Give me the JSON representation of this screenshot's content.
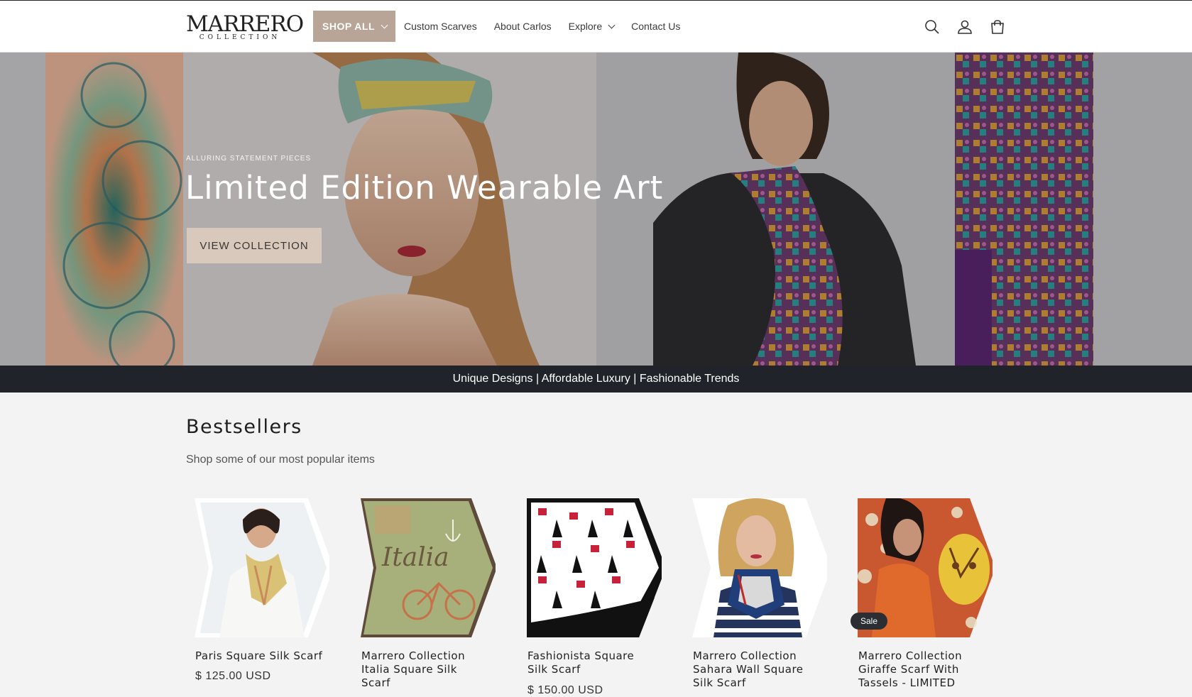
{
  "header": {
    "logo_text": "MARRERO",
    "logo_sub": "COLLECTION",
    "nav": [
      {
        "label": "SHOP ALL",
        "dropdown": true,
        "active": true
      },
      {
        "label": "Custom Scarves"
      },
      {
        "label": "About Carlos"
      },
      {
        "label": "Explore",
        "dropdown": true
      },
      {
        "label": "Contact Us"
      }
    ],
    "icons": [
      "search-icon",
      "account-icon",
      "cart-icon"
    ]
  },
  "hero": {
    "subheading": "ALLURING STATEMENT PIECES",
    "title": "Limited Edition Wearable Art",
    "button": "VIEW COLLECTION"
  },
  "announcement": "Unique Designs | Affordable Luxury | Fashionable Trends",
  "bestsellers": {
    "title": "Bestsellers",
    "subtitle": "Shop some of our most popular items",
    "products": [
      {
        "name": "Paris Square Silk Scarf",
        "price": "$ 125.00 USD"
      },
      {
        "name": "Marrero Collection Italia Square Silk Scarf",
        "price": ""
      },
      {
        "name": "Fashionista Square Silk Scarf",
        "price": "$ 150.00 USD"
      },
      {
        "name": "Marrero Collection Sahara Wall Square Silk Scarf",
        "price": ""
      },
      {
        "name": "Marrero Collection Giraffe Scarf With Tassels - LIMITED",
        "price": "",
        "badge": "Sale"
      }
    ]
  },
  "colors": {
    "accent": "#b8a597",
    "button": "#d8c9bc",
    "announcement_bg": "#20242a"
  }
}
